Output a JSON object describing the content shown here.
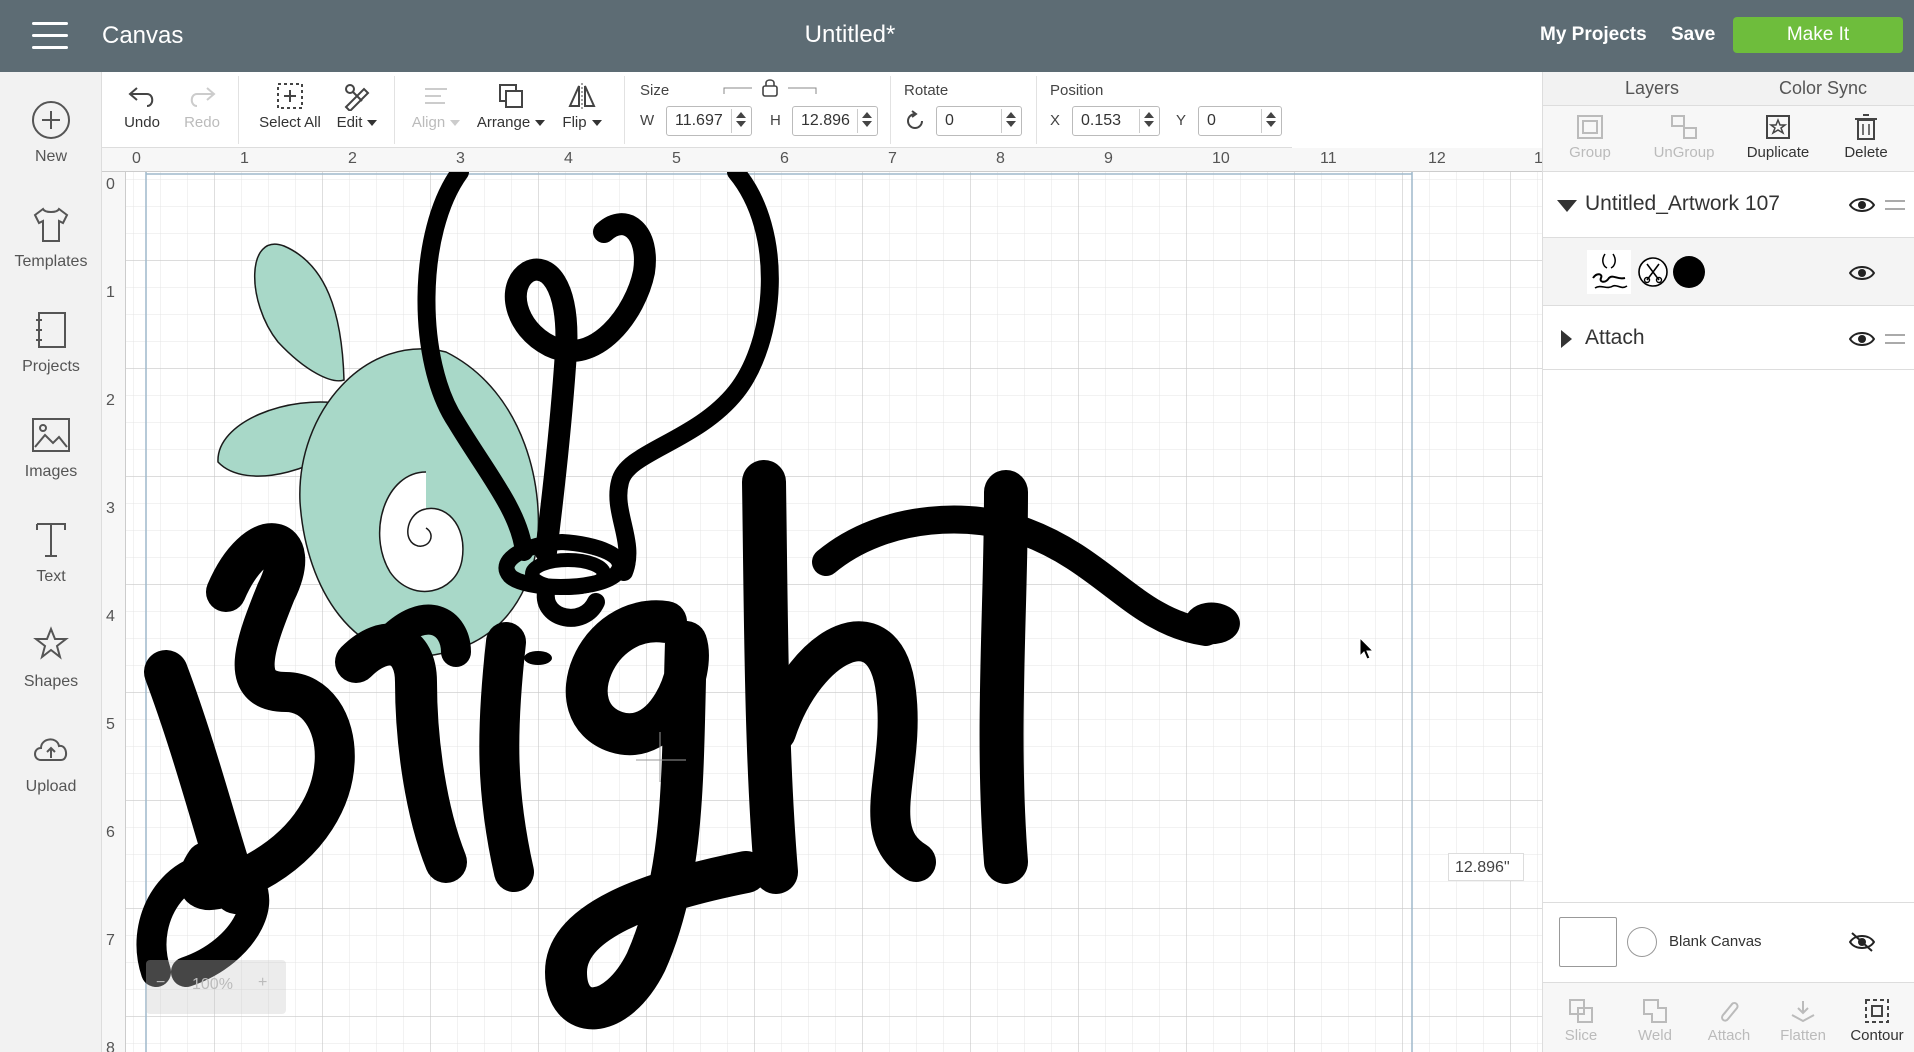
{
  "header": {
    "app_title": "Canvas",
    "doc_title": "Untitled*",
    "my_projects": "My Projects",
    "save": "Save",
    "make_it": "Make It",
    "accent_color": "#6ebd3c",
    "bar_color": "#5d6c74"
  },
  "sidebar": {
    "items": [
      {
        "label": "New",
        "icon": "plus-circle-icon"
      },
      {
        "label": "Templates",
        "icon": "tshirt-icon"
      },
      {
        "label": "Projects",
        "icon": "notebook-icon"
      },
      {
        "label": "Images",
        "icon": "image-icon"
      },
      {
        "label": "Text",
        "icon": "text-icon"
      },
      {
        "label": "Shapes",
        "icon": "shapes-icon"
      },
      {
        "label": "Upload",
        "icon": "cloud-upload-icon"
      }
    ]
  },
  "toolbar": {
    "undo": "Undo",
    "redo": "Redo",
    "select_all": "Select All",
    "edit": "Edit",
    "align": "Align",
    "arrange": "Arrange",
    "flip": "Flip",
    "size_label": "Size",
    "w_label": "W",
    "w_value": "11.697",
    "h_label": "H",
    "h_value": "12.896",
    "rotate_label": "Rotate",
    "rotate_value": "0",
    "position_label": "Position",
    "x_label": "X",
    "x_value": "0.153",
    "y_label": "Y",
    "y_value": "0"
  },
  "canvas": {
    "ruler_top": [
      "0",
      "1",
      "2",
      "3",
      "4",
      "5",
      "6",
      "7",
      "8",
      "9",
      "10",
      "11",
      "12",
      "1"
    ],
    "ruler_left": [
      "0",
      "1",
      "2",
      "3",
      "4",
      "5",
      "6",
      "7",
      "8"
    ],
    "zoom_value": "100%",
    "zoom_minus": "−",
    "zoom_plus": "+",
    "height_readout": "12.896\"",
    "artwork_colors": {
      "ink": "#000000",
      "mint": "#a8d8c8"
    }
  },
  "right_panel": {
    "tabs": [
      "Layers",
      "Color Sync"
    ],
    "tools": [
      {
        "label": "Group",
        "enabled": false
      },
      {
        "label": "UnGroup",
        "enabled": false
      },
      {
        "label": "Duplicate",
        "enabled": true
      },
      {
        "label": "Delete",
        "enabled": true
      }
    ],
    "layers": [
      {
        "name": "Untitled_Artwork 107",
        "expanded": true
      },
      {
        "name": "Attach",
        "expanded": false
      }
    ],
    "blank_canvas": "Blank Canvas",
    "bottom_tools": [
      {
        "label": "Slice",
        "enabled": false
      },
      {
        "label": "Weld",
        "enabled": false
      },
      {
        "label": "Attach",
        "enabled": false
      },
      {
        "label": "Flatten",
        "enabled": false
      },
      {
        "label": "Contour",
        "enabled": true
      }
    ]
  }
}
